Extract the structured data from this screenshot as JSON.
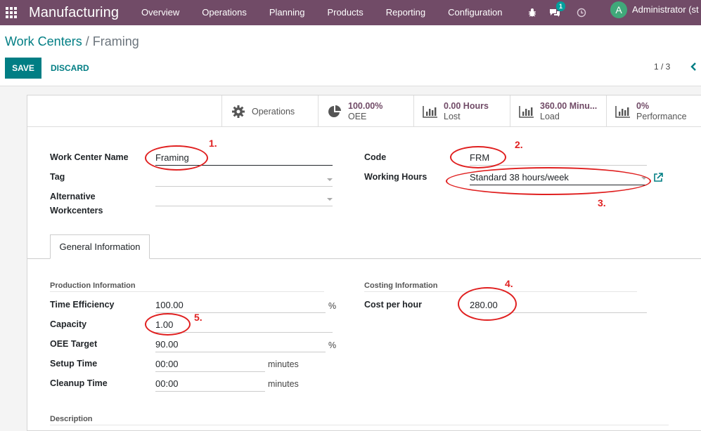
{
  "navbar": {
    "brand": "Manufacturing",
    "menu": [
      "Overview",
      "Operations",
      "Planning",
      "Products",
      "Reporting",
      "Configuration"
    ],
    "chat_count": "1",
    "avatar_letter": "A",
    "user": "Administrator (st"
  },
  "breadcrumb": {
    "parent": "Work Centers",
    "separator": "/",
    "current": "Framing"
  },
  "buttons": {
    "save": "SAVE",
    "discard": "DISCARD"
  },
  "pager": "1 / 3",
  "smart_buttons": [
    {
      "icon": "gear-icon",
      "label": "Operations"
    },
    {
      "icon": "pie-chart-icon",
      "value": "100.00%",
      "label": "OEE"
    },
    {
      "icon": "bar-chart-icon",
      "value": "0.00 Hours",
      "label": "Lost"
    },
    {
      "icon": "bar-chart-icon",
      "value": "360.00 Minu...",
      "label": "Load"
    },
    {
      "icon": "bar-chart-icon",
      "value": "0%",
      "label": "Performance"
    }
  ],
  "form": {
    "work_center_name_label": "Work Center Name",
    "work_center_name": "Framing",
    "tag_label": "Tag",
    "alt_workcenters_label_1": "Alternative",
    "alt_workcenters_label_2": "Workcenters",
    "code_label": "Code",
    "code": "FRM",
    "working_hours_label": "Working Hours",
    "working_hours": "Standard 38 hours/week"
  },
  "tabs": {
    "general": "General Information"
  },
  "production": {
    "title": "Production Information",
    "time_efficiency_label": "Time Efficiency",
    "time_efficiency": "100.00",
    "capacity_label": "Capacity",
    "capacity": "1.00",
    "oee_target_label": "OEE Target",
    "oee_target": "90.00",
    "setup_time_label": "Setup Time",
    "setup_time": "00:00",
    "cleanup_time_label": "Cleanup Time",
    "cleanup_time": "00:00",
    "percent_unit": "%",
    "minutes_unit": "minutes"
  },
  "costing": {
    "title": "Costing Information",
    "cost_per_hour_label": "Cost per hour",
    "cost_per_hour": "280.00"
  },
  "description_title": "Description",
  "annotations": [
    "1.",
    "2.",
    "3.",
    "4.",
    "5."
  ]
}
